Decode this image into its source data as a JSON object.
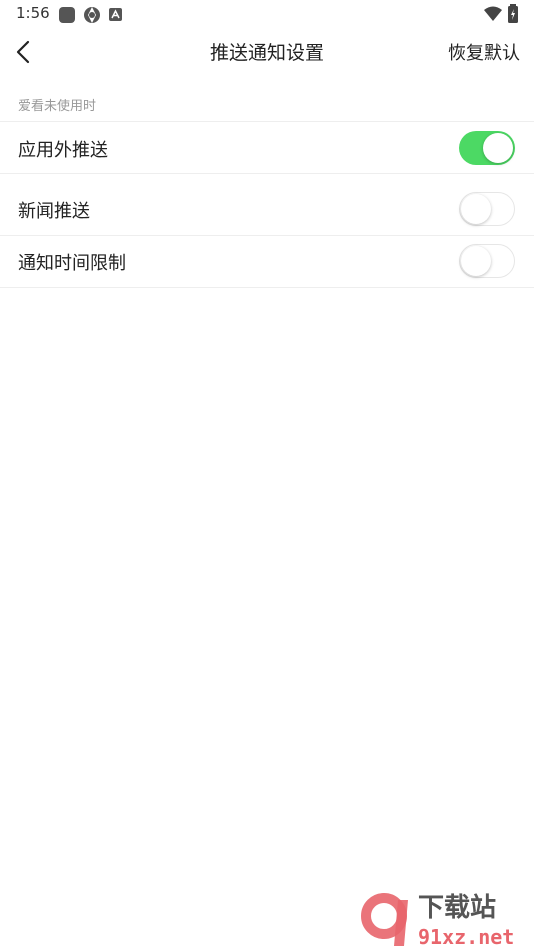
{
  "status_bar": {
    "time": "1:56"
  },
  "header": {
    "title": "推送通知设置",
    "reset_label": "恢复默认"
  },
  "section": {
    "label": "爱看未使用时"
  },
  "settings": [
    {
      "label": "应用外推送",
      "enabled": true
    },
    {
      "label": "新闻推送",
      "enabled": false
    },
    {
      "label": "通知时间限制",
      "enabled": false
    }
  ],
  "colors": {
    "toggle_on": "#4cd964",
    "text": "#222222",
    "muted": "#999999"
  },
  "watermark": {
    "text_cn": "下载站",
    "text_domain": "91xz.net"
  }
}
